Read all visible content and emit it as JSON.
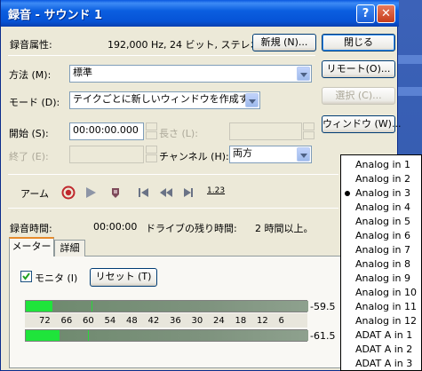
{
  "window": {
    "title": "録音 - サウンド 1",
    "help": "?",
    "close": "✕"
  },
  "format": {
    "label": "録音属性:",
    "value": "192,000 Hz, 24 ビット, ステレオ"
  },
  "buttons": {
    "new": "新規 (N)...",
    "close": "閉じる",
    "remote": "リモート(O)...",
    "select": "選択 (C)...",
    "window": "ウィンドウ (W)...",
    "reset": "リセット (T)"
  },
  "method": {
    "label": "方法 (M):",
    "value": "標準"
  },
  "mode": {
    "label": "モード (D):",
    "value": "テイクごとに新しいウィンドウを作成する"
  },
  "start": {
    "label": "開始 (S):",
    "value": "00:00:00.000"
  },
  "length": {
    "label": "長さ (L):"
  },
  "end": {
    "label": "終了 (E):"
  },
  "channel": {
    "label": "チャンネル (H):",
    "value": "両方"
  },
  "transport": {
    "label": "アーム",
    "counter": "1.23"
  },
  "status": {
    "rec_time_label": "録音時間:",
    "rec_time_value": "00:00:00",
    "remaining_label": "ドライブの残り時間:",
    "remaining_value": "2 時間以上。"
  },
  "tabs": [
    "メーター",
    "詳細"
  ],
  "monitor": {
    "label": "モニタ (I)",
    "checked": true
  },
  "meters": {
    "left_value": "-59.5",
    "right_value": "-61.5",
    "left_level": 0.095,
    "right_level": 0.12,
    "scale": [
      "72",
      "66",
      "60",
      "54",
      "48",
      "42",
      "36",
      "30",
      "24",
      "18",
      "12",
      "6"
    ]
  },
  "channel_dropdown": {
    "selected": "Analog in 3",
    "options": [
      "Analog in 1",
      "Analog in 2",
      "Analog in 3",
      "Analog in 4",
      "Analog in 5",
      "Analog in 6",
      "Analog in 7",
      "Analog in 8",
      "Analog in 9",
      "Analog in 10",
      "Analog in 11",
      "Analog in 12",
      "ADAT A in 1",
      "ADAT A in 2",
      "ADAT A in 3"
    ]
  },
  "colors": {
    "title_bar": "#0a58e0",
    "meter_fill": "#1fe43b",
    "close_button": "#c63d1c"
  }
}
